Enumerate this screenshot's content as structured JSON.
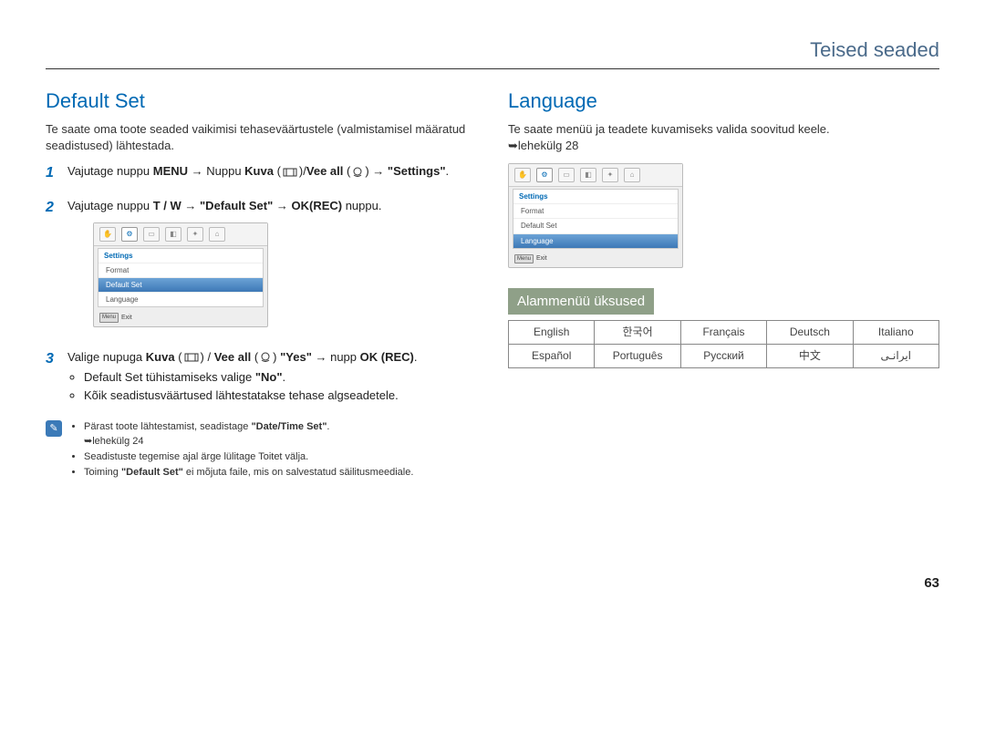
{
  "header": {
    "section": "Teised seaded"
  },
  "pagenum": "63",
  "left": {
    "title": "Default Set",
    "intro": "Te saate oma toote seaded vaikimisi tehaseväärtustele (valmistamisel määratud seadistused) lähtestada.",
    "step1_pre": "Vajutage nuppu ",
    "step1_menu": "MENU",
    "step1_arrow": " → Nuppu ",
    "step1_kuva": "Kuva",
    "step1_mid": "/",
    "step1_vee": "Vee all",
    "step1_end": " → ",
    "step1_settings_quote": "\"Settings\"",
    "step2_pre": "Vajutage nuppu ",
    "step2_tw": "T / W",
    "step2_arrow1": " → ",
    "step2_default": "\"Default Set\"",
    "step2_arrow2": " → ",
    "step2_okrec": "OK(REC)",
    "step2_end": " nuppu.",
    "step3_pre": "Valige nupuga ",
    "step3_kuva": "Kuva",
    "step3_mid": " / ",
    "step3_vee": "Vee all",
    "step3_yes": " \"Yes\"",
    "step3_arrow": " → nupp ",
    "step3_ok": "OK (REC)",
    "step3_end": ".",
    "bullet1": "Default Set tühistamiseks valige ",
    "bullet1_no": "\"No\"",
    "bullet1_end": ".",
    "bullet2": "Kõik seadistusväärtused lähtestatakse tehase algseadetele.",
    "info1": "Pärast toote lähtestamist, seadistage ",
    "info1_b": "\"Date/Time Set\"",
    "info1_end": ". ",
    "info1_page": "➥lehekülg 24",
    "info2": "Seadistuste tegemise ajal ärge lülitage Toitet välja.",
    "info3_pre": "Toiming ",
    "info3_b": "\"Default Set\"",
    "info3_end": " ei mõjuta faile, mis on salvestatud säilitusmeediale.",
    "scr": {
      "title": "Settings",
      "rows": [
        "Format",
        "Default Set",
        "Language"
      ],
      "exit_btn": "Menu",
      "exit": "Exit"
    }
  },
  "right": {
    "title": "Language",
    "intro": "Te saate menüü ja teadete kuvamiseks valida soovitud keele.",
    "pageref": "➥lehekülg 28",
    "scr": {
      "title": "Settings",
      "rows": [
        "Format",
        "Default Set",
        "Language"
      ],
      "exit_btn": "Menu",
      "exit": "Exit"
    },
    "subbanner": "Alammenüü üksused",
    "langs": [
      [
        "English",
        "한국어",
        "Français",
        "Deutsch",
        "Italiano"
      ],
      [
        "Español",
        "Português",
        "Русский",
        "中文",
        "ﺍﻳﺮﺍﻧـﯽ"
      ]
    ]
  }
}
